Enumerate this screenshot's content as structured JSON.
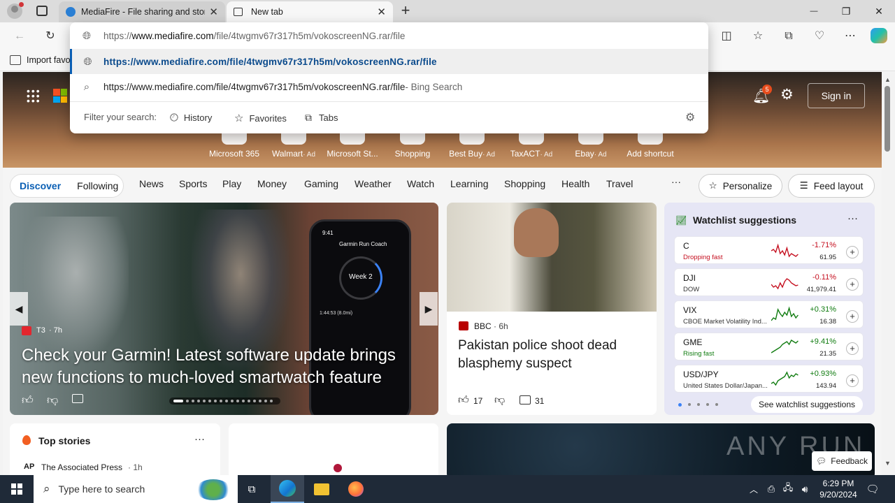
{
  "tabs": [
    {
      "title": "MediaFire - File sharing and stora",
      "close": "✕"
    },
    {
      "title": "New tab",
      "close": "✕"
    }
  ],
  "new_tab_symbol": "+",
  "window_controls": {
    "minimize": "—",
    "restore": "❐",
    "close": "✕"
  },
  "favorites_bar": {
    "import_label": "Import favo"
  },
  "omnibox": {
    "typed_prefix": "https://",
    "typed_domain": "www.mediafire.com",
    "typed_path": "/file/4twgmv67r317h5m/vokoscreenNG.rar/file",
    "suggestion_url": "https://www.mediafire.com/file/4twgmv67r317h5m/vokoscreenNG.rar/file",
    "search_text": "https://www.mediafire.com/file/4twgmv67r317h5m/vokoscreenNG.rar/file",
    "search_suffix": " - Bing Search",
    "filter_label": "Filter your search:",
    "filters": [
      "History",
      "Favorites",
      "Tabs"
    ]
  },
  "header": {
    "notification_count": "5",
    "sign_in": "Sign in"
  },
  "quick_links": [
    {
      "label": "Microsoft 365",
      "ad": ""
    },
    {
      "label": "Walmart",
      "ad": "· Ad"
    },
    {
      "label": "Microsoft St...",
      "ad": ""
    },
    {
      "label": "Shopping",
      "ad": ""
    },
    {
      "label": "Best Buy",
      "ad": "· Ad"
    },
    {
      "label": "TaxACT",
      "ad": "· Ad"
    },
    {
      "label": "Ebay",
      "ad": "· Ad"
    },
    {
      "label": "Add shortcut",
      "ad": ""
    }
  ],
  "feed_tabs": {
    "discover": "Discover",
    "following": "Following"
  },
  "nav_items": [
    "News",
    "Sports",
    "Play",
    "Money",
    "Gaming",
    "Weather",
    "Watch",
    "Learning",
    "Shopping",
    "Health",
    "Travel"
  ],
  "more": "···",
  "personalize": "Personalize",
  "feed_layout": "Feed layout",
  "hero_story": {
    "source": "T3",
    "age": "· 7h",
    "headline": "Check your Garmin! Latest software update brings new functions to much-loved smartwatch feature",
    "watch_title": "Garmin Run Coach",
    "watch_week": "Week 2",
    "watch_time": "9:41",
    "watch_stat": "1:44:53 (8.0mi)"
  },
  "bbc_story": {
    "source": "BBC",
    "age": "· 6h",
    "headline": "Pakistan police shoot dead blasphemy suspect",
    "likes": "17",
    "comments": "31"
  },
  "watchlist": {
    "title": "Watchlist suggestions",
    "footer": "See watchlist suggestions",
    "items": [
      {
        "symbol": "C",
        "name": "Dropping fast",
        "change": "-1.71%",
        "price": "61.95",
        "up": false
      },
      {
        "symbol": "DJI",
        "name": "DOW",
        "change": "-0.11%",
        "price": "41,979.41",
        "up": false
      },
      {
        "symbol": "VIX",
        "name": "CBOE Market Volatility Ind...",
        "change": "+0.31%",
        "price": "16.38",
        "up": true
      },
      {
        "symbol": "GME",
        "name": "Rising fast",
        "change": "+9.41%",
        "price": "21.35",
        "up": true
      },
      {
        "symbol": "USD/JPY",
        "name": "United States Dollar/Japan...",
        "change": "+0.93%",
        "price": "143.94",
        "up": true
      }
    ]
  },
  "top_stories": {
    "title": "Top stories",
    "source": "The Associated Press",
    "age": "· 1h"
  },
  "feedback": "Feedback",
  "watermark": "ANY RUN",
  "taskbar": {
    "search_placeholder": "Type here to search",
    "time": "6:29 PM",
    "date": "9/20/2024"
  },
  "colors": {
    "accent": "#0a5fb4",
    "red": "#c50f1f",
    "green": "#0f7b0f",
    "taskbar": "#1f2a38"
  }
}
